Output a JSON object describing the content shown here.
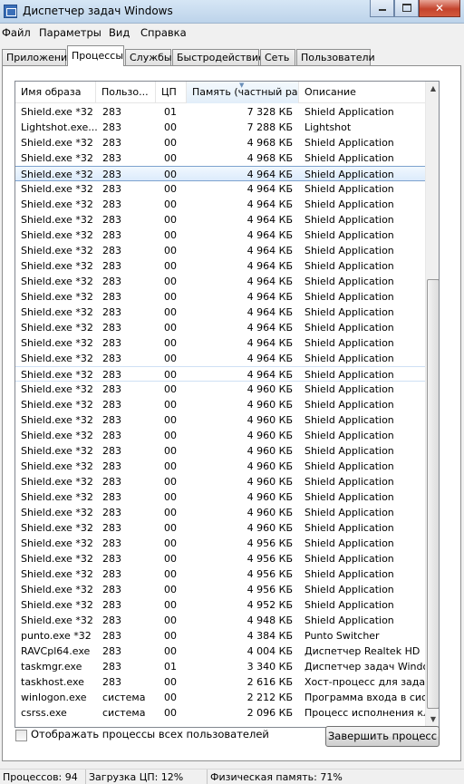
{
  "window": {
    "title": "Диспетчер задач Windows"
  },
  "menu": [
    "Файл",
    "Параметры",
    "Вид",
    "Справка"
  ],
  "tabs": [
    {
      "label": "Приложения",
      "active": false
    },
    {
      "label": "Процессы",
      "active": true
    },
    {
      "label": "Службы",
      "active": false
    },
    {
      "label": "Быстродействие",
      "active": false
    },
    {
      "label": "Сеть",
      "active": false
    },
    {
      "label": "Пользователи",
      "active": false
    }
  ],
  "columns": {
    "name": "Имя образа",
    "user": "Пользо...",
    "cpu": "ЦП",
    "memory": "Память (частный ра...",
    "description": "Описание"
  },
  "processes": [
    {
      "name": "Shield.exe *32",
      "user": "283",
      "cpu": "01",
      "mem": "7 328 КБ",
      "desc": "Shield Application"
    },
    {
      "name": "Lightshot.exe...",
      "user": "283",
      "cpu": "00",
      "mem": "7 288 КБ",
      "desc": "Lightshot"
    },
    {
      "name": "Shield.exe *32",
      "user": "283",
      "cpu": "00",
      "mem": "4 968 КБ",
      "desc": "Shield Application"
    },
    {
      "name": "Shield.exe *32",
      "user": "283",
      "cpu": "00",
      "mem": "4 968 КБ",
      "desc": "Shield Application"
    },
    {
      "name": "Shield.exe *32",
      "user": "283",
      "cpu": "00",
      "mem": "4 964 КБ",
      "desc": "Shield Application"
    },
    {
      "name": "Shield.exe *32",
      "user": "283",
      "cpu": "00",
      "mem": "4 964 КБ",
      "desc": "Shield Application"
    },
    {
      "name": "Shield.exe *32",
      "user": "283",
      "cpu": "00",
      "mem": "4 964 КБ",
      "desc": "Shield Application"
    },
    {
      "name": "Shield.exe *32",
      "user": "283",
      "cpu": "00",
      "mem": "4 964 КБ",
      "desc": "Shield Application"
    },
    {
      "name": "Shield.exe *32",
      "user": "283",
      "cpu": "00",
      "mem": "4 964 КБ",
      "desc": "Shield Application"
    },
    {
      "name": "Shield.exe *32",
      "user": "283",
      "cpu": "00",
      "mem": "4 964 КБ",
      "desc": "Shield Application"
    },
    {
      "name": "Shield.exe *32",
      "user": "283",
      "cpu": "00",
      "mem": "4 964 КБ",
      "desc": "Shield Application"
    },
    {
      "name": "Shield.exe *32",
      "user": "283",
      "cpu": "00",
      "mem": "4 964 КБ",
      "desc": "Shield Application"
    },
    {
      "name": "Shield.exe *32",
      "user": "283",
      "cpu": "00",
      "mem": "4 964 КБ",
      "desc": "Shield Application"
    },
    {
      "name": "Shield.exe *32",
      "user": "283",
      "cpu": "00",
      "mem": "4 964 КБ",
      "desc": "Shield Application"
    },
    {
      "name": "Shield.exe *32",
      "user": "283",
      "cpu": "00",
      "mem": "4 964 КБ",
      "desc": "Shield Application"
    },
    {
      "name": "Shield.exe *32",
      "user": "283",
      "cpu": "00",
      "mem": "4 964 КБ",
      "desc": "Shield Application"
    },
    {
      "name": "Shield.exe *32",
      "user": "283",
      "cpu": "00",
      "mem": "4 964 КБ",
      "desc": "Shield Application"
    },
    {
      "name": "Shield.exe *32",
      "user": "283",
      "cpu": "00",
      "mem": "4 964 КБ",
      "desc": "Shield Application"
    },
    {
      "name": "Shield.exe *32",
      "user": "283",
      "cpu": "00",
      "mem": "4 960 КБ",
      "desc": "Shield Application"
    },
    {
      "name": "Shield.exe *32",
      "user": "283",
      "cpu": "00",
      "mem": "4 960 КБ",
      "desc": "Shield Application"
    },
    {
      "name": "Shield.exe *32",
      "user": "283",
      "cpu": "00",
      "mem": "4 960 КБ",
      "desc": "Shield Application"
    },
    {
      "name": "Shield.exe *32",
      "user": "283",
      "cpu": "00",
      "mem": "4 960 КБ",
      "desc": "Shield Application"
    },
    {
      "name": "Shield.exe *32",
      "user": "283",
      "cpu": "00",
      "mem": "4 960 КБ",
      "desc": "Shield Application"
    },
    {
      "name": "Shield.exe *32",
      "user": "283",
      "cpu": "00",
      "mem": "4 960 КБ",
      "desc": "Shield Application"
    },
    {
      "name": "Shield.exe *32",
      "user": "283",
      "cpu": "00",
      "mem": "4 960 КБ",
      "desc": "Shield Application"
    },
    {
      "name": "Shield.exe *32",
      "user": "283",
      "cpu": "00",
      "mem": "4 960 КБ",
      "desc": "Shield Application"
    },
    {
      "name": "Shield.exe *32",
      "user": "283",
      "cpu": "00",
      "mem": "4 960 КБ",
      "desc": "Shield Application"
    },
    {
      "name": "Shield.exe *32",
      "user": "283",
      "cpu": "00",
      "mem": "4 960 КБ",
      "desc": "Shield Application"
    },
    {
      "name": "Shield.exe *32",
      "user": "283",
      "cpu": "00",
      "mem": "4 956 КБ",
      "desc": "Shield Application"
    },
    {
      "name": "Shield.exe *32",
      "user": "283",
      "cpu": "00",
      "mem": "4 956 КБ",
      "desc": "Shield Application"
    },
    {
      "name": "Shield.exe *32",
      "user": "283",
      "cpu": "00",
      "mem": "4 956 КБ",
      "desc": "Shield Application"
    },
    {
      "name": "Shield.exe *32",
      "user": "283",
      "cpu": "00",
      "mem": "4 956 КБ",
      "desc": "Shield Application"
    },
    {
      "name": "Shield.exe *32",
      "user": "283",
      "cpu": "00",
      "mem": "4 952 КБ",
      "desc": "Shield Application"
    },
    {
      "name": "Shield.exe *32",
      "user": "283",
      "cpu": "00",
      "mem": "4 948 КБ",
      "desc": "Shield Application"
    },
    {
      "name": "punto.exe *32",
      "user": "283",
      "cpu": "00",
      "mem": "4 384 КБ",
      "desc": "Punto Switcher"
    },
    {
      "name": "RAVCpl64.exe",
      "user": "283",
      "cpu": "00",
      "mem": "4 004 КБ",
      "desc": "Диспетчер Realtek HD"
    },
    {
      "name": "taskmgr.exe",
      "user": "283",
      "cpu": "01",
      "mem": "3 340 КБ",
      "desc": "Диспетчер задач Windows"
    },
    {
      "name": "taskhost.exe",
      "user": "283",
      "cpu": "00",
      "mem": "2 616 КБ",
      "desc": "Хост-процесс для задач W"
    },
    {
      "name": "winlogon.exe",
      "user": "система",
      "cpu": "00",
      "mem": "2 212 КБ",
      "desc": "Программа входа в систе"
    },
    {
      "name": "csrss.exe",
      "user": "система",
      "cpu": "00",
      "mem": "2 096 КБ",
      "desc": "Процесс исполнения клие"
    }
  ],
  "selected_row_index": 4,
  "focus_row_index": 17,
  "show_all_label": "Отображать процессы всех пользователей",
  "end_process_label": "Завершить процесс",
  "status": {
    "processes": "Процессов: 94",
    "cpu": "Загрузка ЦП: 12%",
    "memory": "Физическая память: 71%"
  }
}
